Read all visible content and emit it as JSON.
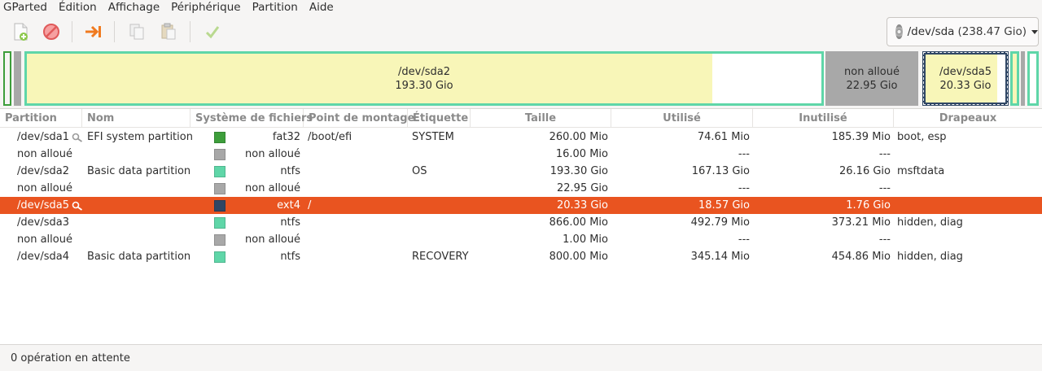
{
  "menu": [
    "GParted",
    "Édition",
    "Affichage",
    "Périphérique",
    "Partition",
    "Aide"
  ],
  "toolbar": {
    "icons": [
      "new-partition-icon",
      "delete-icon",
      "resize-move-icon",
      "copy-icon",
      "paste-icon",
      "apply-icon"
    ]
  },
  "device": {
    "name": "/dev/sda",
    "size": "(238.47 Gio)"
  },
  "partition_bar": {
    "sda2": {
      "name": "/dev/sda2",
      "size": "193.30 Gio"
    },
    "unalloc": {
      "name": "non alloué",
      "size": "22.95 Gio"
    },
    "sda5": {
      "name": "/dev/sda5",
      "size": "20.33 Gio"
    }
  },
  "colors": {
    "accent": "#e95420",
    "fat32": "#3d9e3b",
    "ntfs": "#5fd6a8",
    "ext4": "#2f4664",
    "unallocated": "#a8a8a8",
    "used": "#f8f6b8"
  },
  "columns": [
    "Partition",
    "Nom",
    "Système de fichiers",
    "Point de montage",
    "Étiquette",
    "Taille",
    "Utilisé",
    "Inutilisé",
    "Drapeaux"
  ],
  "rows": [
    {
      "partition": "/dev/sda1",
      "key": true,
      "name": "EFI system partition",
      "fs": "fat32",
      "fs_color": "#3d9e3b",
      "mount": "/boot/efi",
      "label": "SYSTEM",
      "size": "260.00 Mio",
      "used": "74.61 Mio",
      "unused": "185.39 Mio",
      "flags": "boot, esp"
    },
    {
      "partition": "non alloué",
      "key": false,
      "name": "",
      "fs": "non alloué",
      "fs_color": "#a8a8a8",
      "mount": "",
      "label": "",
      "size": "16.00 Mio",
      "used": "---",
      "unused": "---",
      "flags": ""
    },
    {
      "partition": "/dev/sda2",
      "key": false,
      "name": "Basic data partition",
      "fs": "ntfs",
      "fs_color": "#5fd6a8",
      "mount": "",
      "label": "OS",
      "size": "193.30 Gio",
      "used": "167.13 Gio",
      "unused": "26.16 Gio",
      "flags": "msftdata"
    },
    {
      "partition": "non alloué",
      "key": false,
      "name": "",
      "fs": "non alloué",
      "fs_color": "#a8a8a8",
      "mount": "",
      "label": "",
      "size": "22.95 Gio",
      "used": "---",
      "unused": "---",
      "flags": ""
    },
    {
      "partition": "/dev/sda5",
      "key": true,
      "name": "",
      "fs": "ext4",
      "fs_color": "#2f4664",
      "mount": "/",
      "label": "",
      "size": "20.33 Gio",
      "used": "18.57 Gio",
      "unused": "1.76 Gio",
      "flags": "",
      "selected": true
    },
    {
      "partition": "/dev/sda3",
      "key": false,
      "name": "",
      "fs": "ntfs",
      "fs_color": "#5fd6a8",
      "mount": "",
      "label": "",
      "size": "866.00 Mio",
      "used": "492.79 Mio",
      "unused": "373.21 Mio",
      "flags": "hidden, diag"
    },
    {
      "partition": "non alloué",
      "key": false,
      "name": "",
      "fs": "non alloué",
      "fs_color": "#a8a8a8",
      "mount": "",
      "label": "",
      "size": "1.00 Mio",
      "used": "---",
      "unused": "---",
      "flags": ""
    },
    {
      "partition": "/dev/sda4",
      "key": false,
      "name": "Basic data partition",
      "fs": "ntfs",
      "fs_color": "#5fd6a8",
      "mount": "",
      "label": "RECOVERY",
      "size": "800.00 Mio",
      "used": "345.14 Mio",
      "unused": "454.86 Mio",
      "flags": "hidden, diag"
    }
  ],
  "status": "0 opération en attente"
}
